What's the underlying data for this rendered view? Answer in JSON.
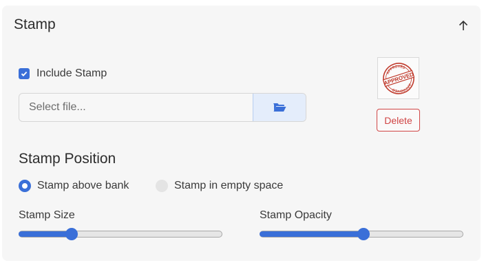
{
  "header": {
    "title": "Stamp",
    "collapse_icon": "arrow-up-icon"
  },
  "include_stamp": {
    "label": "Include Stamp",
    "checked": true
  },
  "file": {
    "placeholder": "Select file...",
    "value": "",
    "browse_icon": "folder-open-icon"
  },
  "stamp_preview": {
    "arc_top": "APPROVED",
    "center_text": "APPROVED",
    "arc_bottom": "APPROVED"
  },
  "delete_button": {
    "label": "Delete"
  },
  "position": {
    "title": "Stamp Position",
    "options": [
      {
        "label": "Stamp above bank",
        "selected": true
      },
      {
        "label": "Stamp in empty space",
        "selected": false
      }
    ]
  },
  "sliders": {
    "size": {
      "label": "Stamp Size",
      "value": 0.26
    },
    "opacity": {
      "label": "Stamp Opacity",
      "value": 0.51
    }
  },
  "colors": {
    "accent": "#3a6fd8",
    "danger": "#d04545",
    "stamp": "#c0392b"
  }
}
